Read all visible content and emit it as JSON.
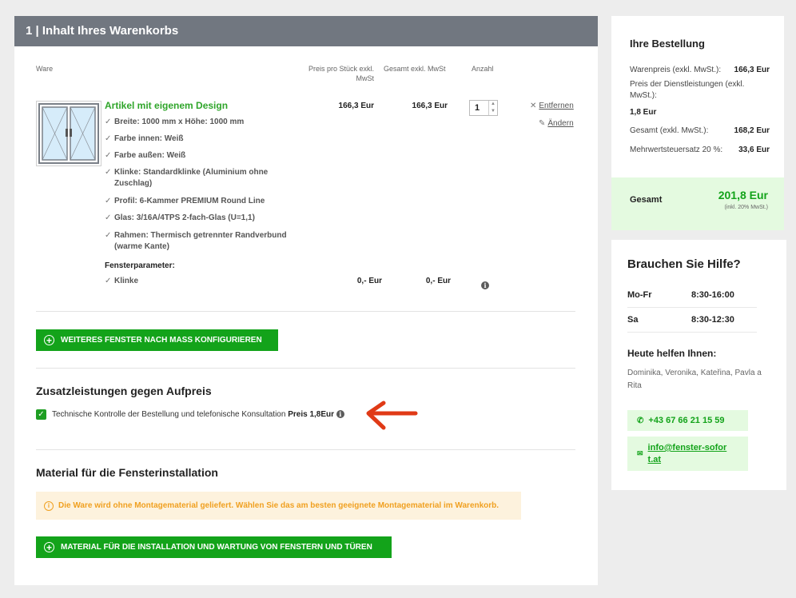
{
  "cart": {
    "title": "1 | Inhalt Ihres Warenkorbs",
    "columns": {
      "ware": "Ware",
      "unit_price": "Preis pro Stück exkl. MwSt",
      "total": "Gesamt exkl. MwSt",
      "qty": "Anzahl"
    },
    "item": {
      "title": "Artikel mit eigenem Design",
      "features": [
        "Breite: 1000 mm x Höhe: 1000 mm",
        "Farbe innen: Weiß",
        "Farbe außen: Weiß",
        "Klinke: Standardklinke (Aluminium ohne Zuschlag)",
        "Profil: 6-Kammer PREMIUM Round Line",
        "Glas: 3/16A/4TPS 2-fach-Glas (U=1,1)",
        "Rahmen: Thermisch getrennter Randverbund (warme Kante)"
      ],
      "unit_price": "166,3 Eur",
      "total": "166,3 Eur",
      "qty": "1",
      "remove": "Entfernen",
      "edit": "Ändern",
      "params_title": "Fensterparameter:",
      "param": {
        "name": "Klinke",
        "unit_price": "0,- Eur",
        "total": "0,- Eur"
      }
    },
    "configure_button": "WEITERES FENSTER NACH MASS KONFIGURIEREN"
  },
  "extras": {
    "title": "Zusatzleistungen gegen Aufpreis",
    "option_label": "Technische Kontrolle der Bestellung und telefonische Konsultation",
    "option_price": "Preis 1,8Eur",
    "checked": true
  },
  "material": {
    "title": "Material für die Fensterinstallation",
    "warning": "Die Ware wird ohne Montagematerial geliefert. Wählen Sie das am besten geeignete Montagematerial im Warenkorb.",
    "button": "MATERIAL FÜR DIE INSTALLATION UND WARTUNG VON FENSTERN UND TÜREN"
  },
  "order": {
    "title": "Ihre Bestellung",
    "goods_label": "Warenpreis (exkl. MwSt.):",
    "goods_value": "166,3 Eur",
    "services_label": "Preis der Dienstleistungen (exkl. MwSt.):",
    "services_value": "1,8 Eur",
    "total_excl_label": "Gesamt (exkl. MwSt.):",
    "total_excl_value": "168,2 Eur",
    "vat_label": "Mehrwertsteuersatz 20 %:",
    "vat_value": "33,6 Eur",
    "total_label": "Gesamt",
    "total_value": "201,8 Eur",
    "total_note": "(inkl. 20% MwSt.)"
  },
  "help": {
    "title": "Brauchen Sie Hilfe?",
    "hours": [
      {
        "day": "Mo-Fr",
        "time": "8:30-16:00"
      },
      {
        "day": "Sa",
        "time": "8:30-12:30"
      }
    ],
    "today_title": "Heute helfen Ihnen:",
    "staff": "Dominika, Veronika, Kateřina, Pavla a Rita",
    "phone": "+43 67 66 21 15 59",
    "email": "info@fenster-sofort.at"
  },
  "colors": {
    "accent_green": "#13a31a",
    "header_gray": "#717780",
    "annotation_red": "#e03a16"
  }
}
